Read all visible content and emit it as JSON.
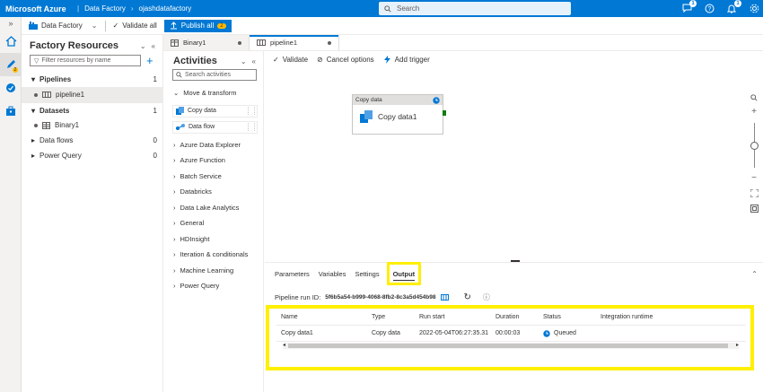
{
  "topbar": {
    "brand": "Microsoft Azure",
    "crumb1": "Data Factory",
    "crumb2": "ojashdatafactory",
    "search_placeholder": "Search",
    "badges": {
      "chat": "1",
      "notifications": "1"
    }
  },
  "toolbar": {
    "data_factory": "Data Factory",
    "validate_all": "Validate all",
    "publish_all": "Publish all",
    "publish_count": "2"
  },
  "rail": {
    "author_badge": "2"
  },
  "resources": {
    "title": "Factory Resources",
    "filter_placeholder": "Filter resources by name",
    "groups": [
      {
        "label": "Pipelines",
        "count": "1"
      },
      {
        "label": "Datasets",
        "count": "1"
      },
      {
        "label": "Data flows",
        "count": "0"
      },
      {
        "label": "Power Query",
        "count": "0"
      }
    ],
    "pipeline_item": "pipeline1",
    "dataset_item": "Binary1"
  },
  "tabs": {
    "tab1": "Binary1",
    "tab2": "pipeline1"
  },
  "activities": {
    "title": "Activities",
    "search_placeholder": "Search activities",
    "move_transform": "Move & transform",
    "copy_data": "Copy data",
    "data_flow": "Data flow",
    "categories": [
      "Azure Data Explorer",
      "Azure Function",
      "Batch Service",
      "Databricks",
      "Data Lake Analytics",
      "General",
      "HDInsight",
      "Iteration & conditionals",
      "Machine Learning",
      "Power Query"
    ]
  },
  "canvas": {
    "validate": "Validate",
    "cancel_options": "Cancel options",
    "add_trigger": "Add trigger",
    "activity_type": "Copy data",
    "activity_name": "Copy data1"
  },
  "bottom": {
    "tabs": [
      "Parameters",
      "Variables",
      "Settings",
      "Output"
    ],
    "run_id_label": "Pipeline run ID:",
    "run_id": "5f6b5a54-b999-4068-8fb2-8c3a5d454b98",
    "columns": [
      "Name",
      "Type",
      "Run start",
      "Duration",
      "Status",
      "Integration runtime"
    ],
    "rows": [
      {
        "name": "Copy data1",
        "type": "Copy data",
        "run_start": "2022-05-04T06:27:35.31",
        "duration": "00:00:03",
        "status": "Queued",
        "runtime": ""
      }
    ]
  },
  "colors": {
    "accent": "#0078d4",
    "highlight": "#ffef00",
    "status_queued": "#0078d4"
  }
}
